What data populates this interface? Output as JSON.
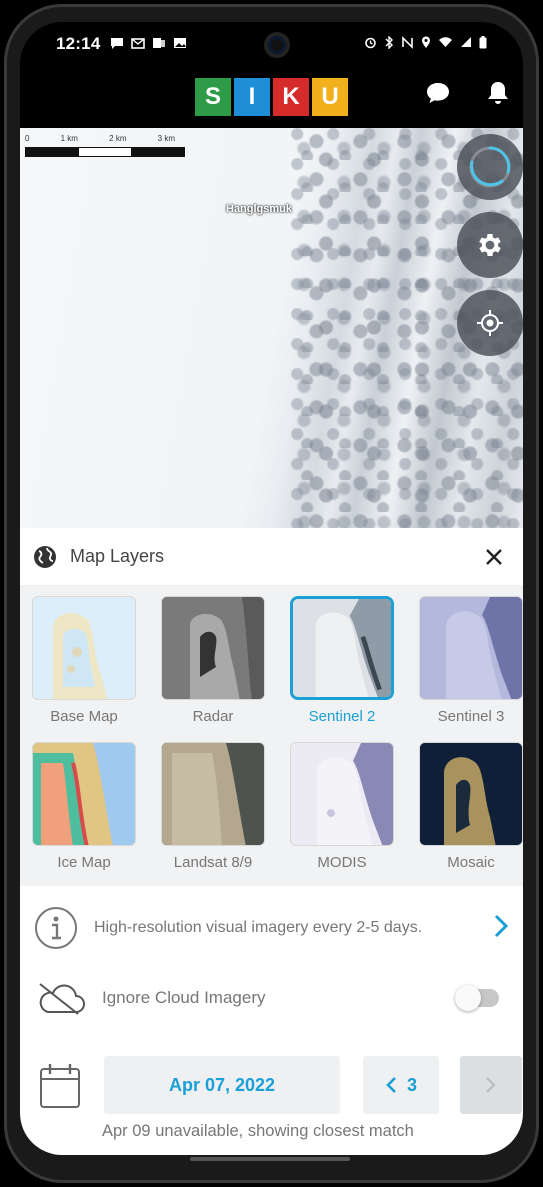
{
  "status_bar": {
    "time": "12:14",
    "left_icons": [
      "message-icon",
      "mail-icon",
      "teams-icon",
      "image-icon"
    ],
    "right_icons": [
      "alarm-icon",
      "bluetooth-icon",
      "nfc-icon",
      "location-icon",
      "wifi-icon",
      "signal-icon",
      "battery-icon"
    ]
  },
  "header": {
    "logo_letters": [
      {
        "char": "S",
        "color": "#2e9b48"
      },
      {
        "char": "I",
        "color": "#1e8fd6"
      },
      {
        "char": "K",
        "color": "#d62b2b"
      },
      {
        "char": "U",
        "color": "#f2b01d"
      }
    ],
    "actions": [
      "chat-icon",
      "bell-icon"
    ]
  },
  "map": {
    "scale_labels": [
      "0",
      "1 km",
      "2 km",
      "3 km"
    ],
    "place_label": "Hanglgsmuk",
    "fabs": [
      "loading-icon",
      "gear-icon",
      "crosshair-icon"
    ]
  },
  "panel": {
    "title": "Map Layers",
    "layers": [
      {
        "label": "Base Map",
        "selected": false
      },
      {
        "label": "Radar",
        "selected": false
      },
      {
        "label": "Sentinel 2",
        "selected": true
      },
      {
        "label": "Sentinel 3",
        "selected": false
      },
      {
        "label": "Ice Map",
        "selected": false
      },
      {
        "label": "Landsat 8/9",
        "selected": false
      },
      {
        "label": "MODIS",
        "selected": false
      },
      {
        "label": "Mosaic",
        "selected": false
      }
    ],
    "info_text": "High-resolution visual imagery every 2-5 days.",
    "cloud_label": "Ignore Cloud Imagery",
    "cloud_toggle_on": false,
    "date": "Apr 07, 2022",
    "day_step": "3",
    "date_note": "Apr 09 unavailable, showing closest match"
  },
  "colors": {
    "accent": "#1a9fd6",
    "muted_text": "#777777"
  }
}
